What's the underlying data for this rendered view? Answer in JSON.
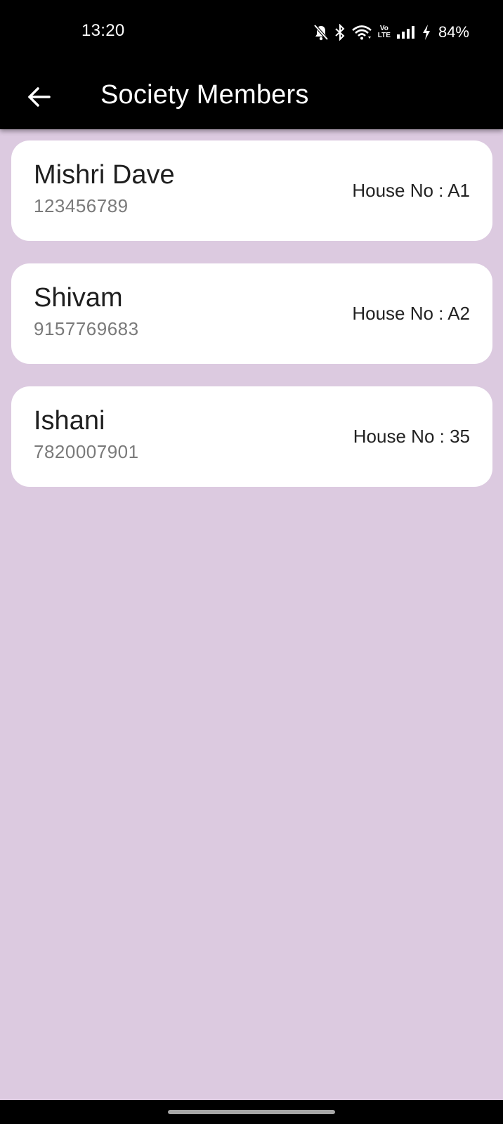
{
  "status_bar": {
    "time": "13:20",
    "battery": "84%",
    "icons": [
      "bell-off-icon",
      "bluetooth-icon",
      "wifi-icon",
      "volte-icon",
      "signal-icon",
      "charging-icon"
    ],
    "volte_top": "Vo",
    "volte_bottom": "LTE"
  },
  "app_bar": {
    "title": "Society Members",
    "back_icon": "arrow-left-icon"
  },
  "members": [
    {
      "name": "Mishri Dave",
      "phone": "123456789",
      "house": "House No : A1"
    },
    {
      "name": "Shivam",
      "phone": "9157769683",
      "house": "House No : A2"
    },
    {
      "name": "Ishani",
      "phone": "7820007901",
      "house": "House No : 35"
    }
  ],
  "colors": {
    "background": "#dccae0",
    "app_bar": "#000000",
    "card": "#ffffff"
  }
}
